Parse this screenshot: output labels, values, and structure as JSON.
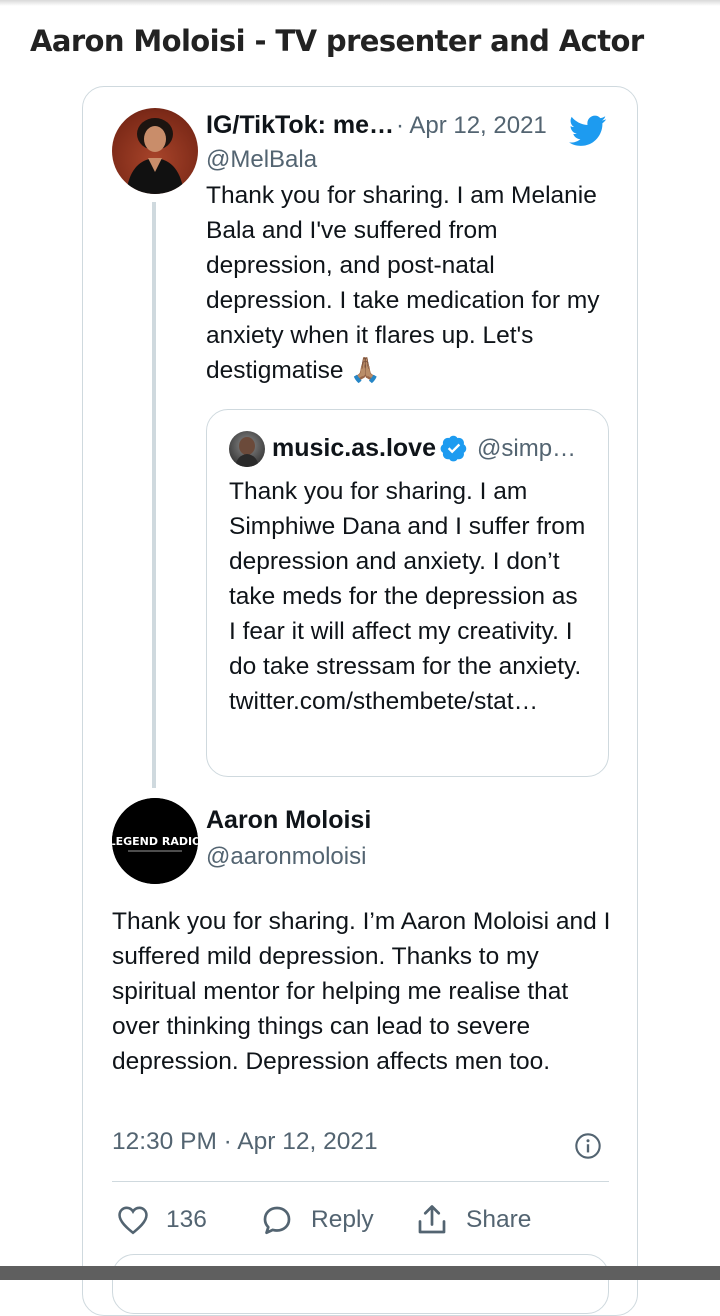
{
  "page": {
    "title": "Aaron Moloisi - TV presenter and Actor"
  },
  "parent_tweet": {
    "name": "IG/TikTok: me…",
    "date": "· Apr 12, 2021",
    "handle": "@MelBala",
    "text": "Thank you for sharing. I am Melanie Bala and I've suffered from depression, and post-natal depression. I take medication for my anxiety when it flares up. Let's destigmatise",
    "emoji": "🙏🏽"
  },
  "quoted_tweet": {
    "name": "music.as.love",
    "handle": "@simp…",
    "text": "Thank you for sharing. I am Simphiwe Dana and I suffer from depression and anxiety. I don’t take meds for the depression as I fear it will affect my creativity. I do take stressam for the anxiety.",
    "link": "twitter.com/sthembete/stat…"
  },
  "main_tweet": {
    "name": "Aaron Moloisi",
    "handle": "@aaronmoloisi",
    "avatar_logo": "LEGEND RADIO",
    "text": "Thank you for sharing. I’m Aaron Moloisi and I suffered mild depression. Thanks to my spiritual mentor for helping me realise that over thinking things can lead to severe depression. Depression affects men too.",
    "timestamp": "12:30 PM · Apr 12, 2021"
  },
  "actions": {
    "like_count": "136",
    "reply_label": "Reply",
    "share_label": "Share"
  },
  "icons": {
    "brand": "twitter-bird-icon",
    "verified": "verified-badge-icon",
    "info": "info-icon",
    "like": "heart-icon",
    "reply": "speech-bubble-icon",
    "share": "share-arrow-icon"
  },
  "colors": {
    "twitter_blue": "#1d9bf0",
    "text_primary": "#0f1419",
    "text_secondary": "#536471",
    "border": "#cfd9de"
  }
}
